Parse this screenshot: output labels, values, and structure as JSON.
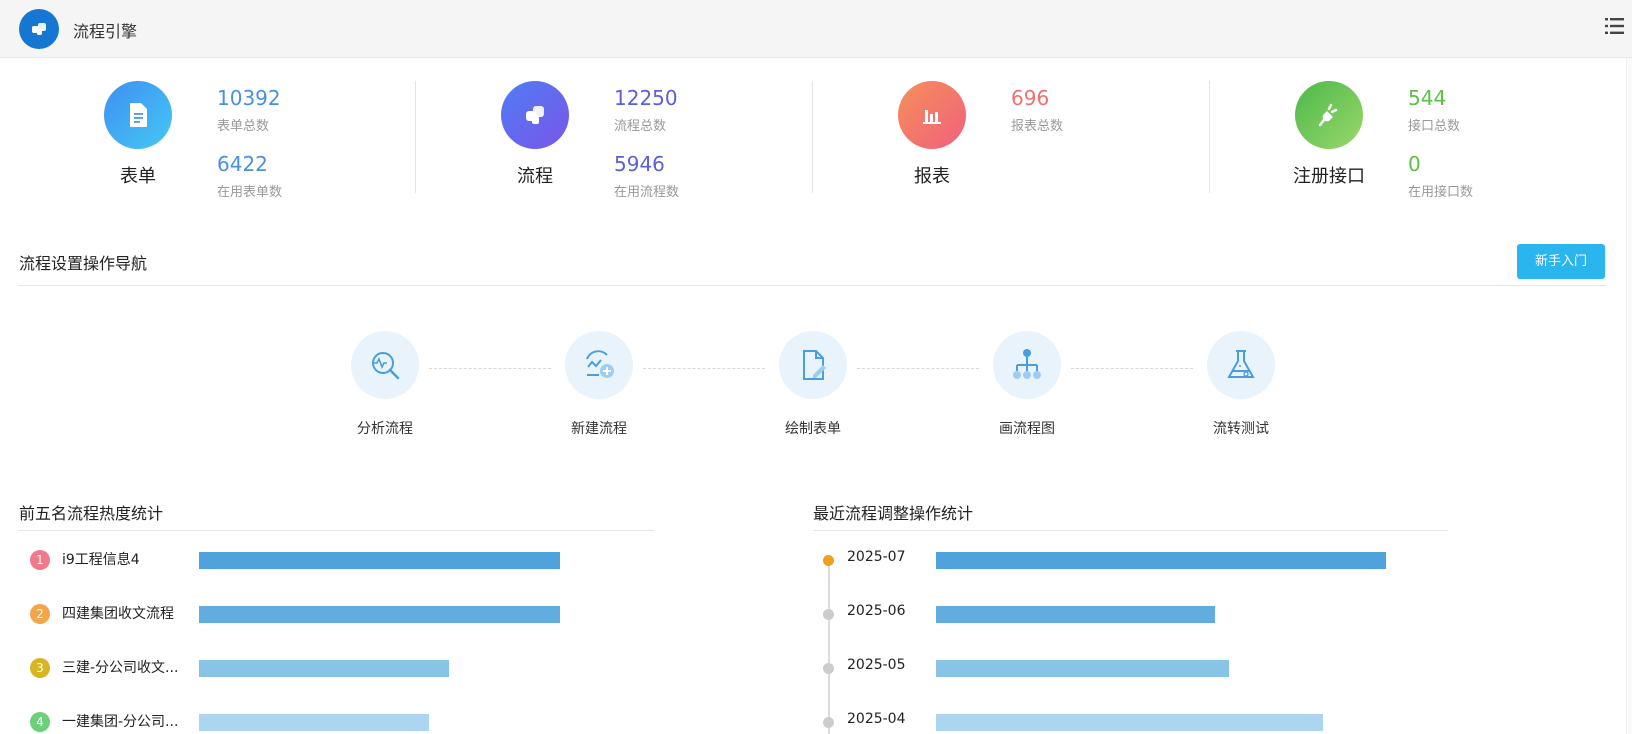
{
  "header": {
    "title": "流程引擎"
  },
  "stats": [
    {
      "label": "表单",
      "total": "10392",
      "total_label": "表单总数",
      "active": "6422",
      "active_label": "在用表单数",
      "color": "#4a90e2"
    },
    {
      "label": "流程",
      "total": "12250",
      "total_label": "流程总数",
      "active": "5946",
      "active_label": "在用流程数",
      "color": "#5b5fd9"
    },
    {
      "label": "报表",
      "total": "696",
      "total_label": "报表总数",
      "color": "#f07070"
    },
    {
      "label": "注册接口",
      "total": "544",
      "total_label": "接口总数",
      "active": "0",
      "active_label": "在用接口数",
      "color": "#5cbf4a"
    }
  ],
  "nav": {
    "title": "流程设置操作导航",
    "guide_button": "新手入门",
    "steps": [
      {
        "label": "分析流程",
        "icon": "analyze-icon"
      },
      {
        "label": "新建流程",
        "icon": "new-flow-icon"
      },
      {
        "label": "绘制表单",
        "icon": "draw-form-icon"
      },
      {
        "label": "画流程图",
        "icon": "flowchart-icon"
      },
      {
        "label": "流转测试",
        "icon": "flask-icon"
      }
    ]
  },
  "ranking": {
    "title": "前五名流程热度统计",
    "items": [
      {
        "rank": "1",
        "name": "i9工程信息4",
        "value": 0.94,
        "color": "#f07a8a"
      },
      {
        "rank": "2",
        "name": "四建集团收文流程",
        "value": 0.94,
        "color": "#f2a54a"
      },
      {
        "rank": "3",
        "name": "三建-分公司收文...",
        "value": 0.65,
        "color": "#d9b522"
      },
      {
        "rank": "4",
        "name": "一建集团-分公司...",
        "value": 0.6,
        "color": "#6ccf7a"
      }
    ],
    "bar_colors": [
      "#4fa2db",
      "#62addf",
      "#88c4e6",
      "#acd6ef"
    ]
  },
  "recent": {
    "title": "最近流程调整操作统计",
    "items": [
      {
        "date": "2025-07",
        "value": 1.0,
        "active": true
      },
      {
        "date": "2025-06",
        "value": 0.62,
        "active": false
      },
      {
        "date": "2025-05",
        "value": 0.65,
        "active": false
      },
      {
        "date": "2025-04",
        "value": 0.86,
        "active": false
      }
    ],
    "bar_colors": [
      "#4fa2db",
      "#62addf",
      "#88c4e6",
      "#acd6ef"
    ],
    "active_dot_color": "#f0a020",
    "dot_color": "#cccccc"
  }
}
